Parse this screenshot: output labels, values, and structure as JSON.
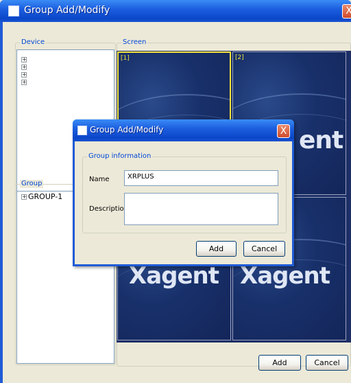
{
  "window": {
    "title": "Group Add/Modify",
    "close": "X"
  },
  "device": {
    "label": "Device",
    "items": [
      "",
      "",
      "",
      ""
    ]
  },
  "screen": {
    "label": "Screen",
    "cells": [
      {
        "num": "[1]",
        "logo": "℘",
        "selected": true
      },
      {
        "num": "[2]",
        "logo": "ent",
        "selected": false
      },
      {
        "num": "",
        "logo": "Xagent",
        "selected": false
      },
      {
        "num": "",
        "logo": "Xagent",
        "selected": false
      }
    ]
  },
  "group": {
    "label": "Group",
    "items": [
      "GROUP-1"
    ]
  },
  "buttons": {
    "add": "Add",
    "cancel": "Cancel"
  },
  "dialog": {
    "title": "Group Add/Modify",
    "close": "X",
    "section_label": "Group information",
    "name_label": "Name",
    "name_value": "XRPLUS",
    "description_label": "Description",
    "description_value": "",
    "add": "Add",
    "cancel": "Cancel"
  }
}
